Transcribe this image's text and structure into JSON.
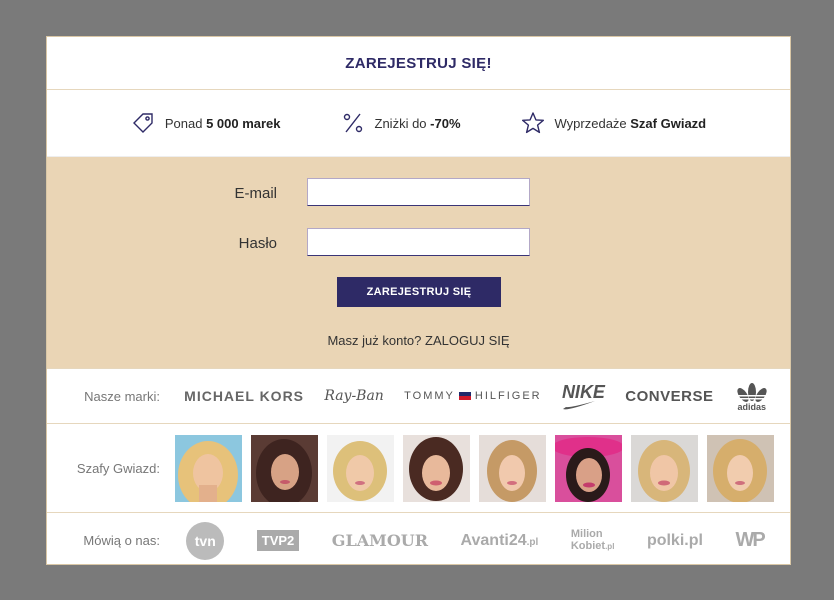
{
  "header": {
    "title": "ZAREJESTRUJ SIĘ!"
  },
  "benefits": [
    {
      "icon": "tag-icon",
      "prefix": "Ponad ",
      "bold": "5 000 marek",
      "suffix": ""
    },
    {
      "icon": "percent-icon",
      "prefix": "Zniżki do ",
      "bold": "-70%",
      "suffix": ""
    },
    {
      "icon": "star-icon",
      "prefix": "Wyprzedaże ",
      "bold": "Szaf Gwiazd",
      "suffix": ""
    }
  ],
  "form": {
    "email_label": "E-mail",
    "email_value": "",
    "password_label": "Hasło",
    "password_value": "",
    "submit_label": "ZAREJESTRUJ SIĘ",
    "login_prompt": "Masz już konto?",
    "login_link": "ZALOGUJ SIĘ"
  },
  "brands": {
    "label": "Nasze marki:",
    "items": [
      "MICHAEL KORS",
      "Ray-Ban",
      "TOMMY",
      "HILFIGER",
      "NIKE",
      "CONVERSE",
      "adidas"
    ]
  },
  "stars": {
    "label": "Szafy Gwiazd:",
    "count_visible": 8
  },
  "press": {
    "label": "Mówią o nas:",
    "items": [
      "tvn",
      "TVP2",
      "GLAMOUR",
      "Avanti24",
      ".pl",
      "Milion",
      "Kobiet",
      ".pl",
      "polki.pl",
      "WP"
    ]
  },
  "colors": {
    "accent": "#2e2a66",
    "beige": "#ead5b5",
    "overlay": "#7a7a7a"
  }
}
